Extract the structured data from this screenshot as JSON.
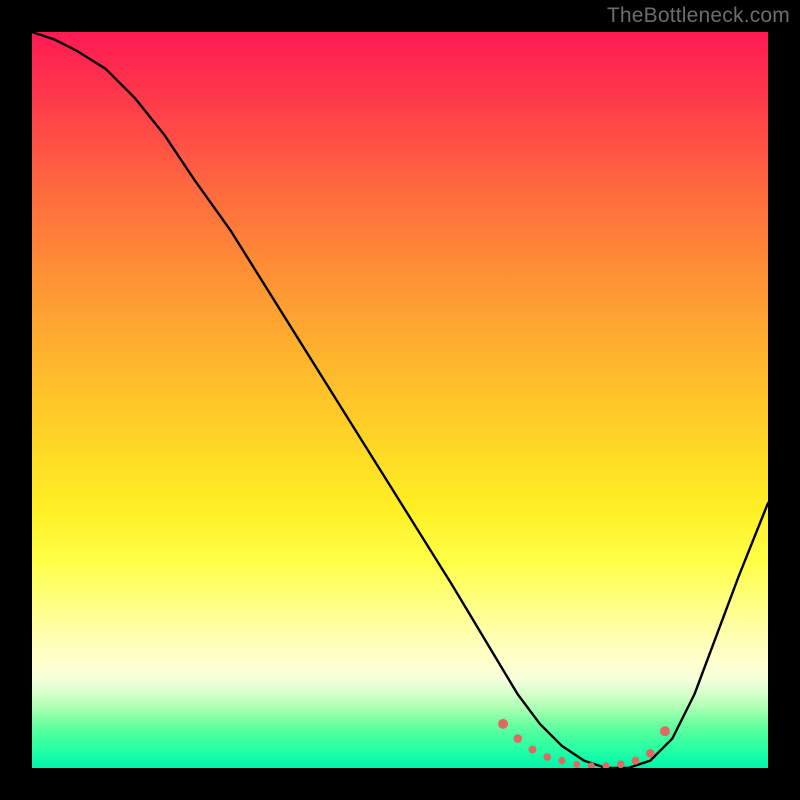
{
  "watermark": "TheBottleneck.com",
  "colors": {
    "frame_bg": "#000000",
    "watermark_text": "#6d6d6d",
    "curve_stroke": "#000000",
    "bead_fill": "#df6962",
    "gradient_top": "#ff1a53",
    "gradient_bottom": "#00f4aa"
  },
  "chart_data": {
    "type": "line",
    "title": "",
    "xlabel": "",
    "ylabel": "",
    "x_range": [
      0,
      100
    ],
    "y_range": [
      0,
      100
    ],
    "grid": false,
    "legend": false,
    "series": [
      {
        "name": "bottleneck-curve",
        "x": [
          0,
          3,
          6,
          10,
          14,
          18,
          22,
          27,
          32,
          37,
          42,
          47,
          52,
          57,
          60,
          63,
          66,
          69,
          72,
          75,
          78,
          81,
          84,
          87,
          90,
          93,
          96,
          100
        ],
        "y": [
          100,
          99,
          97.5,
          95,
          91,
          86,
          80,
          73,
          65,
          57,
          49,
          41,
          33,
          25,
          20,
          15,
          10,
          6,
          3,
          1,
          0,
          0,
          1,
          4,
          10,
          18,
          26,
          36
        ]
      }
    ],
    "valley_markers": {
      "name": "optimal-range",
      "x": [
        64,
        66,
        68,
        70,
        72,
        74,
        76,
        78,
        80,
        82,
        84,
        86
      ],
      "y": [
        6,
        4,
        2.5,
        1.5,
        1,
        0.5,
        0.3,
        0.3,
        0.5,
        1,
        2,
        5
      ],
      "radius": [
        5,
        4.3,
        4,
        3.8,
        3.6,
        3.5,
        3.5,
        3.6,
        3.8,
        4,
        4.3,
        5
      ]
    }
  }
}
